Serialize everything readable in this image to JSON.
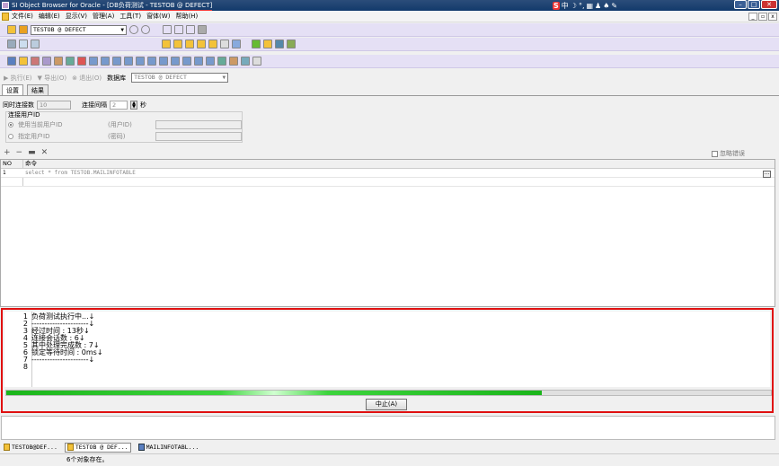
{
  "window": {
    "title": "SI Object Browser for Oracle - [DB负荷测试 - TESTOB @ DEFECT]"
  },
  "menu": [
    "文件(E)",
    "编辑(E)",
    "显示(V)",
    "管理(A)",
    "工具(T)",
    "窗体(W)",
    "帮助(H)"
  ],
  "connection_select": "TESTOB @ DEFECT",
  "run_toolbar": {
    "execute": "执行(E)",
    "export": "导出(O)",
    "stop": "退出(O)",
    "db_label": "数据库",
    "db_value": "TESTOB @ DEFECT"
  },
  "tabs": [
    "设置",
    "结果"
  ],
  "settings": {
    "concurrent_label": "同时连接数",
    "concurrent_value": "10",
    "interval_label": "连接间隔",
    "interval_value": "2",
    "interval_unit": "秒",
    "conn_user_label": "连接用户ID",
    "use_current_label": "使用当前用户ID",
    "specify_label": "指定用户ID",
    "user_id_label": "(用户ID)",
    "password_label": "(密码)"
  },
  "ignore_errors_label": "忽略错误",
  "grid": {
    "headers": [
      "NO",
      "命令"
    ],
    "rows": [
      {
        "no": "1",
        "command": "select * from TESTOB.MAILINFOTABLE"
      }
    ]
  },
  "log_lines": [
    {
      "no": "1",
      "text": "负荷测试执行中...↓"
    },
    {
      "no": "2",
      "text": "----------------------↓"
    },
    {
      "no": "3",
      "text": "经过时间       : 13秒↓"
    },
    {
      "no": "4",
      "text": "连接会话数 : 6↓"
    },
    {
      "no": "5",
      "text": "  其中处理完成数 : 7↓"
    },
    {
      "no": "6",
      "text": "锁定等待时间 : 0ms↓"
    },
    {
      "no": "7",
      "text": "----------------------↓"
    },
    {
      "no": "8",
      "text": ""
    }
  ],
  "progress": 0.7,
  "abort_button": "中止(A)",
  "taskbar": [
    "TESTOB@DEF...",
    "TESTOB @ DEF...",
    "MAILINFOTABL..."
  ],
  "status": "6个对象存在。"
}
